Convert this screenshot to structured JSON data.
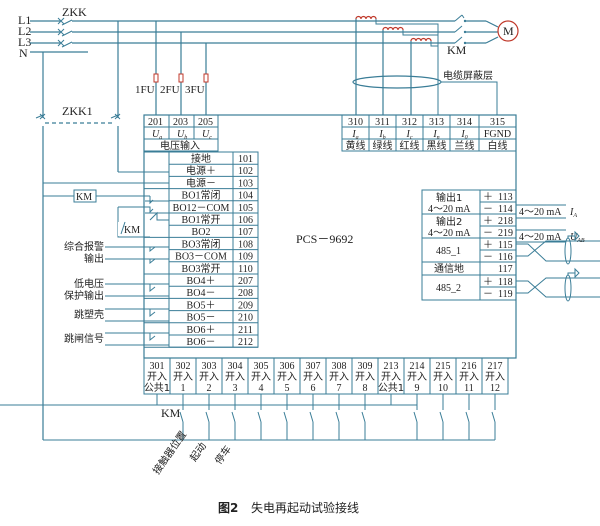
{
  "figure": {
    "caption_number": "图2",
    "caption_title": "失电再起动试验接线"
  },
  "power_lines": {
    "phases": [
      "L1",
      "L2",
      "L3",
      "N"
    ],
    "main_breaker": "ZKK",
    "aux_breaker": "ZKK1",
    "fuses": [
      "1FU",
      "2FU",
      "3FU"
    ],
    "contactor": "KM",
    "motor": "M",
    "cable_shield_label": "电缆屏蔽层"
  },
  "device": {
    "model": "PCS－9692"
  },
  "voltage_input": {
    "terminals": [
      "201",
      "203",
      "205"
    ],
    "symbols": [
      "U",
      "U",
      "U"
    ],
    "subscripts": [
      "a",
      "b",
      "c"
    ],
    "group_label": "电压输入"
  },
  "current_input": {
    "terminals": [
      "310",
      "311",
      "312",
      "313",
      "314",
      "315"
    ],
    "symbols": [
      "I",
      "I",
      "I",
      "I",
      "I",
      "FGND"
    ],
    "subscripts": [
      "a",
      "b",
      "c",
      "n",
      "0",
      ""
    ],
    "wire_colors": [
      "黄线",
      "绿线",
      "红线",
      "黑线",
      "兰线",
      "白线"
    ]
  },
  "left_terminals": [
    {
      "label": "接地",
      "num": "101"
    },
    {
      "label": "电源＋",
      "num": "102"
    },
    {
      "label": "电源－",
      "num": "103"
    },
    {
      "label": "BO1常闭",
      "num": "104"
    },
    {
      "label": "BO12－COM",
      "num": "105"
    },
    {
      "label": "BO1常开",
      "num": "106"
    },
    {
      "label": "BO2",
      "num": "107"
    },
    {
      "label": "BO3常闭",
      "num": "108"
    },
    {
      "label": "BO3－COM",
      "num": "109"
    },
    {
      "label": "BO3常开",
      "num": "110"
    },
    {
      "label": "BO4＋",
      "num": "207"
    },
    {
      "label": "BO4－",
      "num": "208"
    },
    {
      "label": "BO5＋",
      "num": "209"
    },
    {
      "label": "BO5－",
      "num": "210"
    },
    {
      "label": "BO6＋",
      "num": "211"
    },
    {
      "label": "BO6－",
      "num": "212"
    }
  ],
  "left_labels": {
    "km_coil": "KM",
    "km_contact": "KM",
    "alarm_output_line1": "综合报警",
    "alarm_output_line2": "输出",
    "undervoltage_line1": "低电压",
    "undervoltage_line2": "保护输出",
    "trip_mccb": "跳塑壳",
    "trip_signal": "跳闸信号"
  },
  "right_terminals": {
    "out1_label_line1": "输出1",
    "out1_label_line2": "4～20 mA",
    "out1_rows": [
      {
        "sign": "＋",
        "num": "113"
      },
      {
        "sign": "－",
        "num": "114"
      }
    ],
    "out1_signal": "4～20 mA",
    "out1_quantity": "I",
    "out1_sub": "A",
    "out2_label_line1": "输出2",
    "out2_label_line2": "4～20 mA",
    "out2_rows": [
      {
        "sign": "＋",
        "num": "218"
      },
      {
        "sign": "－",
        "num": "219"
      }
    ],
    "out2_signal": "4～20 mA",
    "out2_quantity": "U",
    "out2_sub": "AB",
    "rs485_1_label": "485_1",
    "rs485_1_rows": [
      {
        "sign": "＋",
        "num": "115"
      },
      {
        "sign": "－",
        "num": "116"
      }
    ],
    "comm_ground_label": "通信地",
    "comm_ground_num": "117",
    "rs485_2_label": "485_2",
    "rs485_2_rows": [
      {
        "sign": "＋",
        "num": "118"
      },
      {
        "sign": "－",
        "num": "119"
      }
    ]
  },
  "binary_inputs": [
    {
      "num": "301",
      "line1": "开入",
      "line2": "公共1"
    },
    {
      "num": "302",
      "line1": "开入",
      "line2": "1"
    },
    {
      "num": "303",
      "line1": "开入",
      "line2": "2"
    },
    {
      "num": "304",
      "line1": "开入",
      "line2": "3"
    },
    {
      "num": "305",
      "line1": "开入",
      "line2": "4"
    },
    {
      "num": "306",
      "line1": "开入",
      "line2": "5"
    },
    {
      "num": "307",
      "line1": "开入",
      "line2": "6"
    },
    {
      "num": "308",
      "line1": "开入",
      "line2": "7"
    },
    {
      "num": "309",
      "line1": "开入",
      "line2": "8"
    },
    {
      "num": "213",
      "line1": "开入",
      "line2": "公共1"
    },
    {
      "num": "214",
      "line1": "开入",
      "line2": "9"
    },
    {
      "num": "215",
      "line1": "开入",
      "line2": "10"
    },
    {
      "num": "216",
      "line1": "开入",
      "line2": "11"
    },
    {
      "num": "217",
      "line1": "开入",
      "line2": "12"
    }
  ],
  "binary_input_labels": {
    "km_contact": "KM",
    "contactor_position": "接触器位置",
    "start": "起动",
    "stop": "停车"
  }
}
